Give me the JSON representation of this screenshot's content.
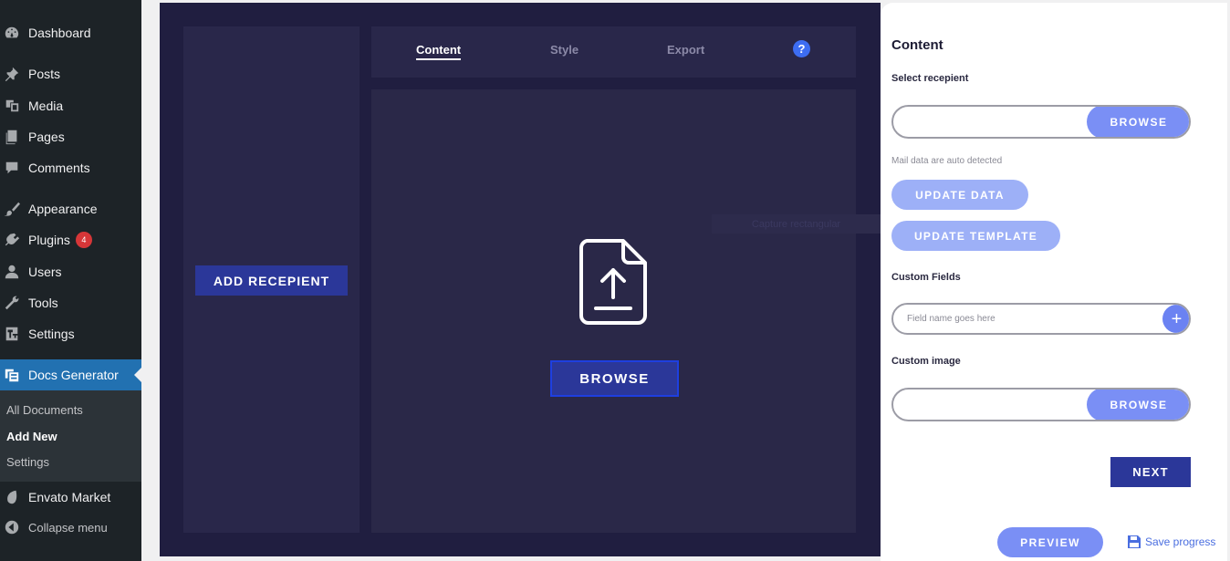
{
  "sidebar": {
    "items": [
      {
        "label": "Dashboard",
        "icon": "dashboard-icon"
      },
      {
        "label": "Posts",
        "icon": "pin-icon"
      },
      {
        "label": "Media",
        "icon": "media-icon"
      },
      {
        "label": "Pages",
        "icon": "pages-icon"
      },
      {
        "label": "Comments",
        "icon": "comment-icon"
      },
      {
        "label": "Appearance",
        "icon": "brush-icon"
      },
      {
        "label": "Plugins",
        "icon": "plugin-icon",
        "badge": "4"
      },
      {
        "label": "Users",
        "icon": "user-icon"
      },
      {
        "label": "Tools",
        "icon": "wrench-icon"
      },
      {
        "label": "Settings",
        "icon": "settings-icon"
      },
      {
        "label": "Docs Generator",
        "icon": "docs-icon"
      },
      {
        "label": "Envato Market",
        "icon": "leaf-icon"
      },
      {
        "label": "Collapse menu",
        "icon": "collapse-icon"
      }
    ],
    "submenu": [
      "All Documents",
      "Add New",
      "Settings"
    ]
  },
  "workspace": {
    "add_recipient": "ADD RECEPIENT",
    "tabs": [
      "Content",
      "Style",
      "Export"
    ],
    "help": "?",
    "browse": "BROWSE",
    "ghost": "Capture rectangular"
  },
  "panel": {
    "title": "Content",
    "select_recipient": "Select recepient",
    "browse1": "BROWSE",
    "hint": "Mail data are auto detected",
    "update_data": "UPDATE DATA",
    "update_template": "UPDATE TEMPLATE",
    "custom_fields": "Custom Fields",
    "field_placeholder": "Field name goes here",
    "plus": "+",
    "custom_image": "Custom image",
    "browse2": "BROWSE",
    "next": "NEXT",
    "preview": "PREVIEW",
    "save": "Save progress"
  },
  "colors": {
    "sidebar_bg": "#1d2327",
    "active_blue": "#2271b1",
    "workspace_bg": "#201e40",
    "primary_button": "#2b3799",
    "accent_button": "#7a8ff5",
    "badge": "#d63638"
  }
}
